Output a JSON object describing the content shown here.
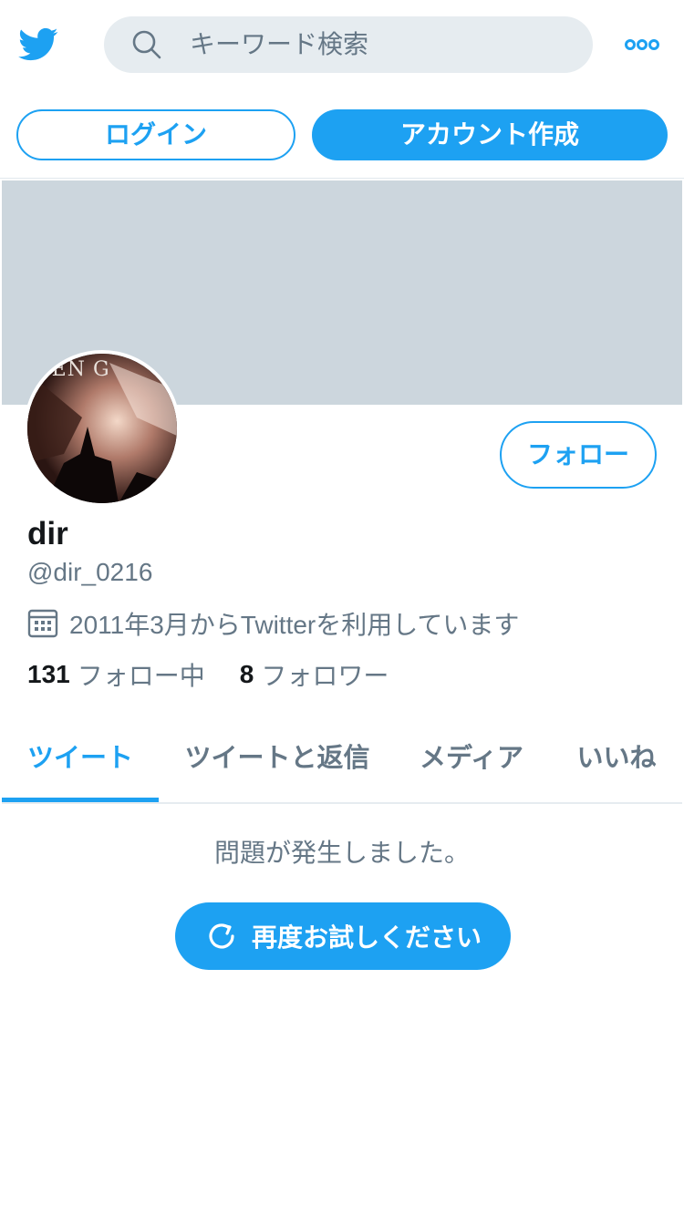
{
  "header": {
    "logo_icon": "twitter-bird-icon",
    "search": {
      "icon": "search-icon",
      "placeholder": "キーワード検索"
    },
    "more_icon": "more-dots-icon"
  },
  "auth": {
    "login_label": "ログイン",
    "signup_label": "アカウント作成"
  },
  "profile": {
    "avatar_text": "X EN G",
    "follow_label": "フォロー",
    "display_name": "dir",
    "handle": "@dir_0216",
    "calendar_icon": "calendar-icon",
    "joined_text": "2011年3月からTwitterを利用しています",
    "following_count": "131",
    "following_label": "フォロー中",
    "followers_count": "8",
    "followers_label": "フォロワー"
  },
  "tabs": [
    {
      "label": "ツイート",
      "active": true
    },
    {
      "label": "ツイートと返信",
      "active": false
    },
    {
      "label": "メディア",
      "active": false
    },
    {
      "label": "いいね",
      "active": false
    }
  ],
  "error": {
    "message": "問題が発生しました。",
    "retry_label": "再度お試しください",
    "retry_icon": "refresh-icon"
  },
  "colors": {
    "accent": "#1da1f2",
    "banner": "#ccd6dd",
    "search_bg": "#e6ecf0",
    "secondary_text": "#657786"
  }
}
